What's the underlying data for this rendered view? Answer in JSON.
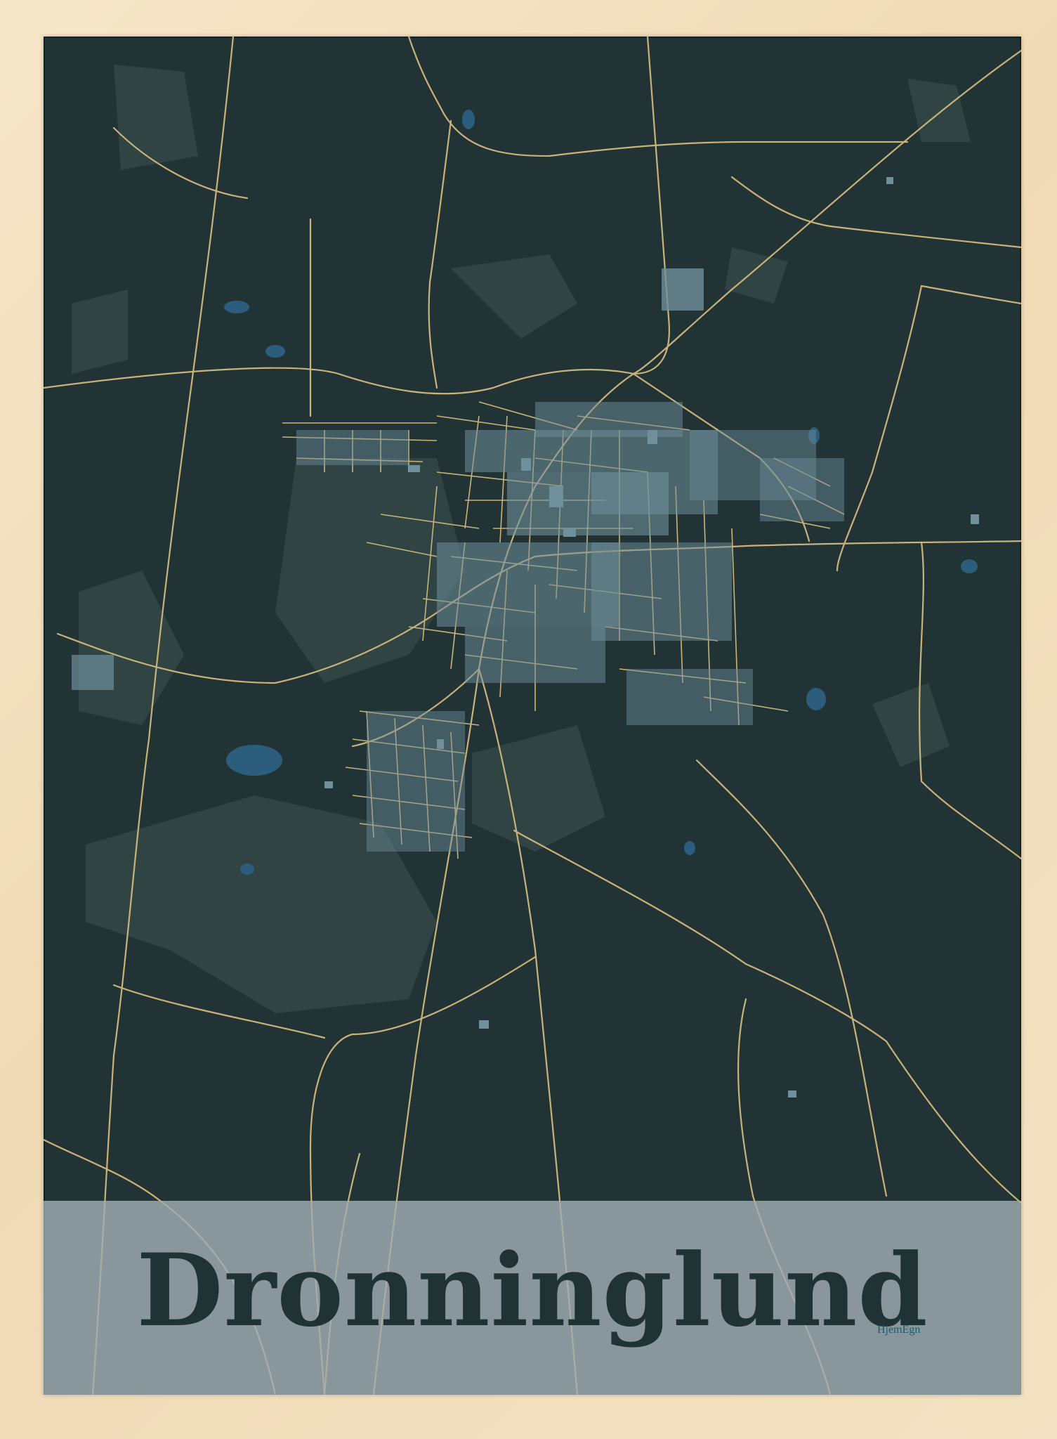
{
  "poster": {
    "title": "Dronninglund",
    "brand": "HjemEgn"
  },
  "colors": {
    "frame": "#f1dfbe",
    "background": "#223335",
    "roads": "#c9b37a",
    "buildings": "#6f8f9b",
    "green_areas": "#2f4443",
    "water": "#2d5d7c",
    "title_band": "#a0acb2",
    "title_text": "#1f3335"
  }
}
